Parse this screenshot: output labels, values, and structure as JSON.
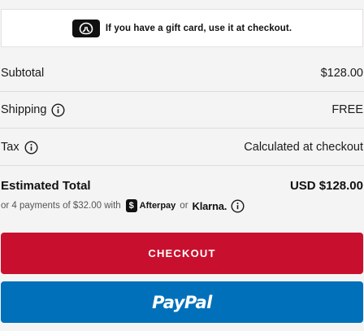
{
  "gift_banner": {
    "icon": "lululemon-logo-icon",
    "text": "If you have a gift card, use it at checkout."
  },
  "summary": {
    "subtotal": {
      "label": "Subtotal",
      "value": "$128.00"
    },
    "shipping": {
      "label": "Shipping",
      "value": "FREE",
      "icon": "info-icon"
    },
    "tax": {
      "label": "Tax",
      "value": "Calculated at checkout",
      "icon": "info-icon"
    }
  },
  "total": {
    "label": "Estimated Total",
    "value": "USD $128.00"
  },
  "installments": {
    "prefix": "or 4 payments of $32.00 with",
    "afterpay_badge": "$",
    "afterpay_label": "Afterpay",
    "or_text": "or",
    "klarna_label": "Klarna.",
    "icon": "info-icon"
  },
  "buttons": {
    "checkout_label": "CHECKOUT",
    "paypal_label": "PayPal"
  },
  "colors": {
    "checkout": "#c8102e",
    "paypal": "#0070ba",
    "background": "#f5f4f4"
  }
}
